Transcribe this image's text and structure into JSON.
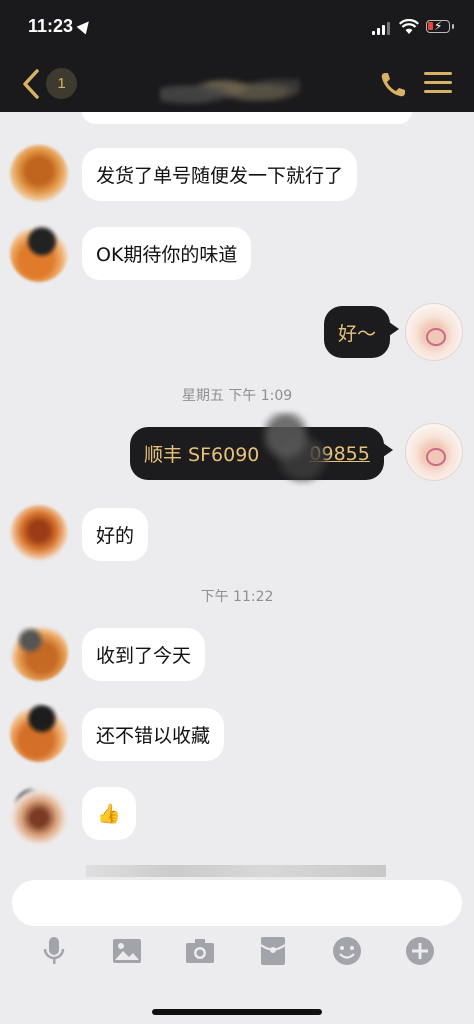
{
  "status_bar": {
    "time": "11:23"
  },
  "nav": {
    "unread_count": "1"
  },
  "messages": [
    {
      "text": "发货了单号随便发一下就行了"
    },
    {
      "text": "OK期待你的味道"
    },
    {
      "text": "好～"
    },
    {
      "text": "顺丰 SF6090",
      "tracking_tail": "09855"
    },
    {
      "text": "好的"
    },
    {
      "text": "收到了今天"
    },
    {
      "text": "还不错以收藏"
    },
    {
      "text": "👍"
    }
  ],
  "timestamps": [
    "星期五 下午 1:09",
    "下午 11:22"
  ],
  "composer": {
    "placeholder": ""
  },
  "toolbar_icons": [
    "microphone-icon",
    "image-icon",
    "camera-icon",
    "red-packet-icon",
    "emoji-icon",
    "plus-icon"
  ],
  "colors": {
    "accent": "#d8b264",
    "dark_bubble": "#1c1c1e",
    "dark_bubble_text": "#e8c27a",
    "background": "#ececef"
  }
}
